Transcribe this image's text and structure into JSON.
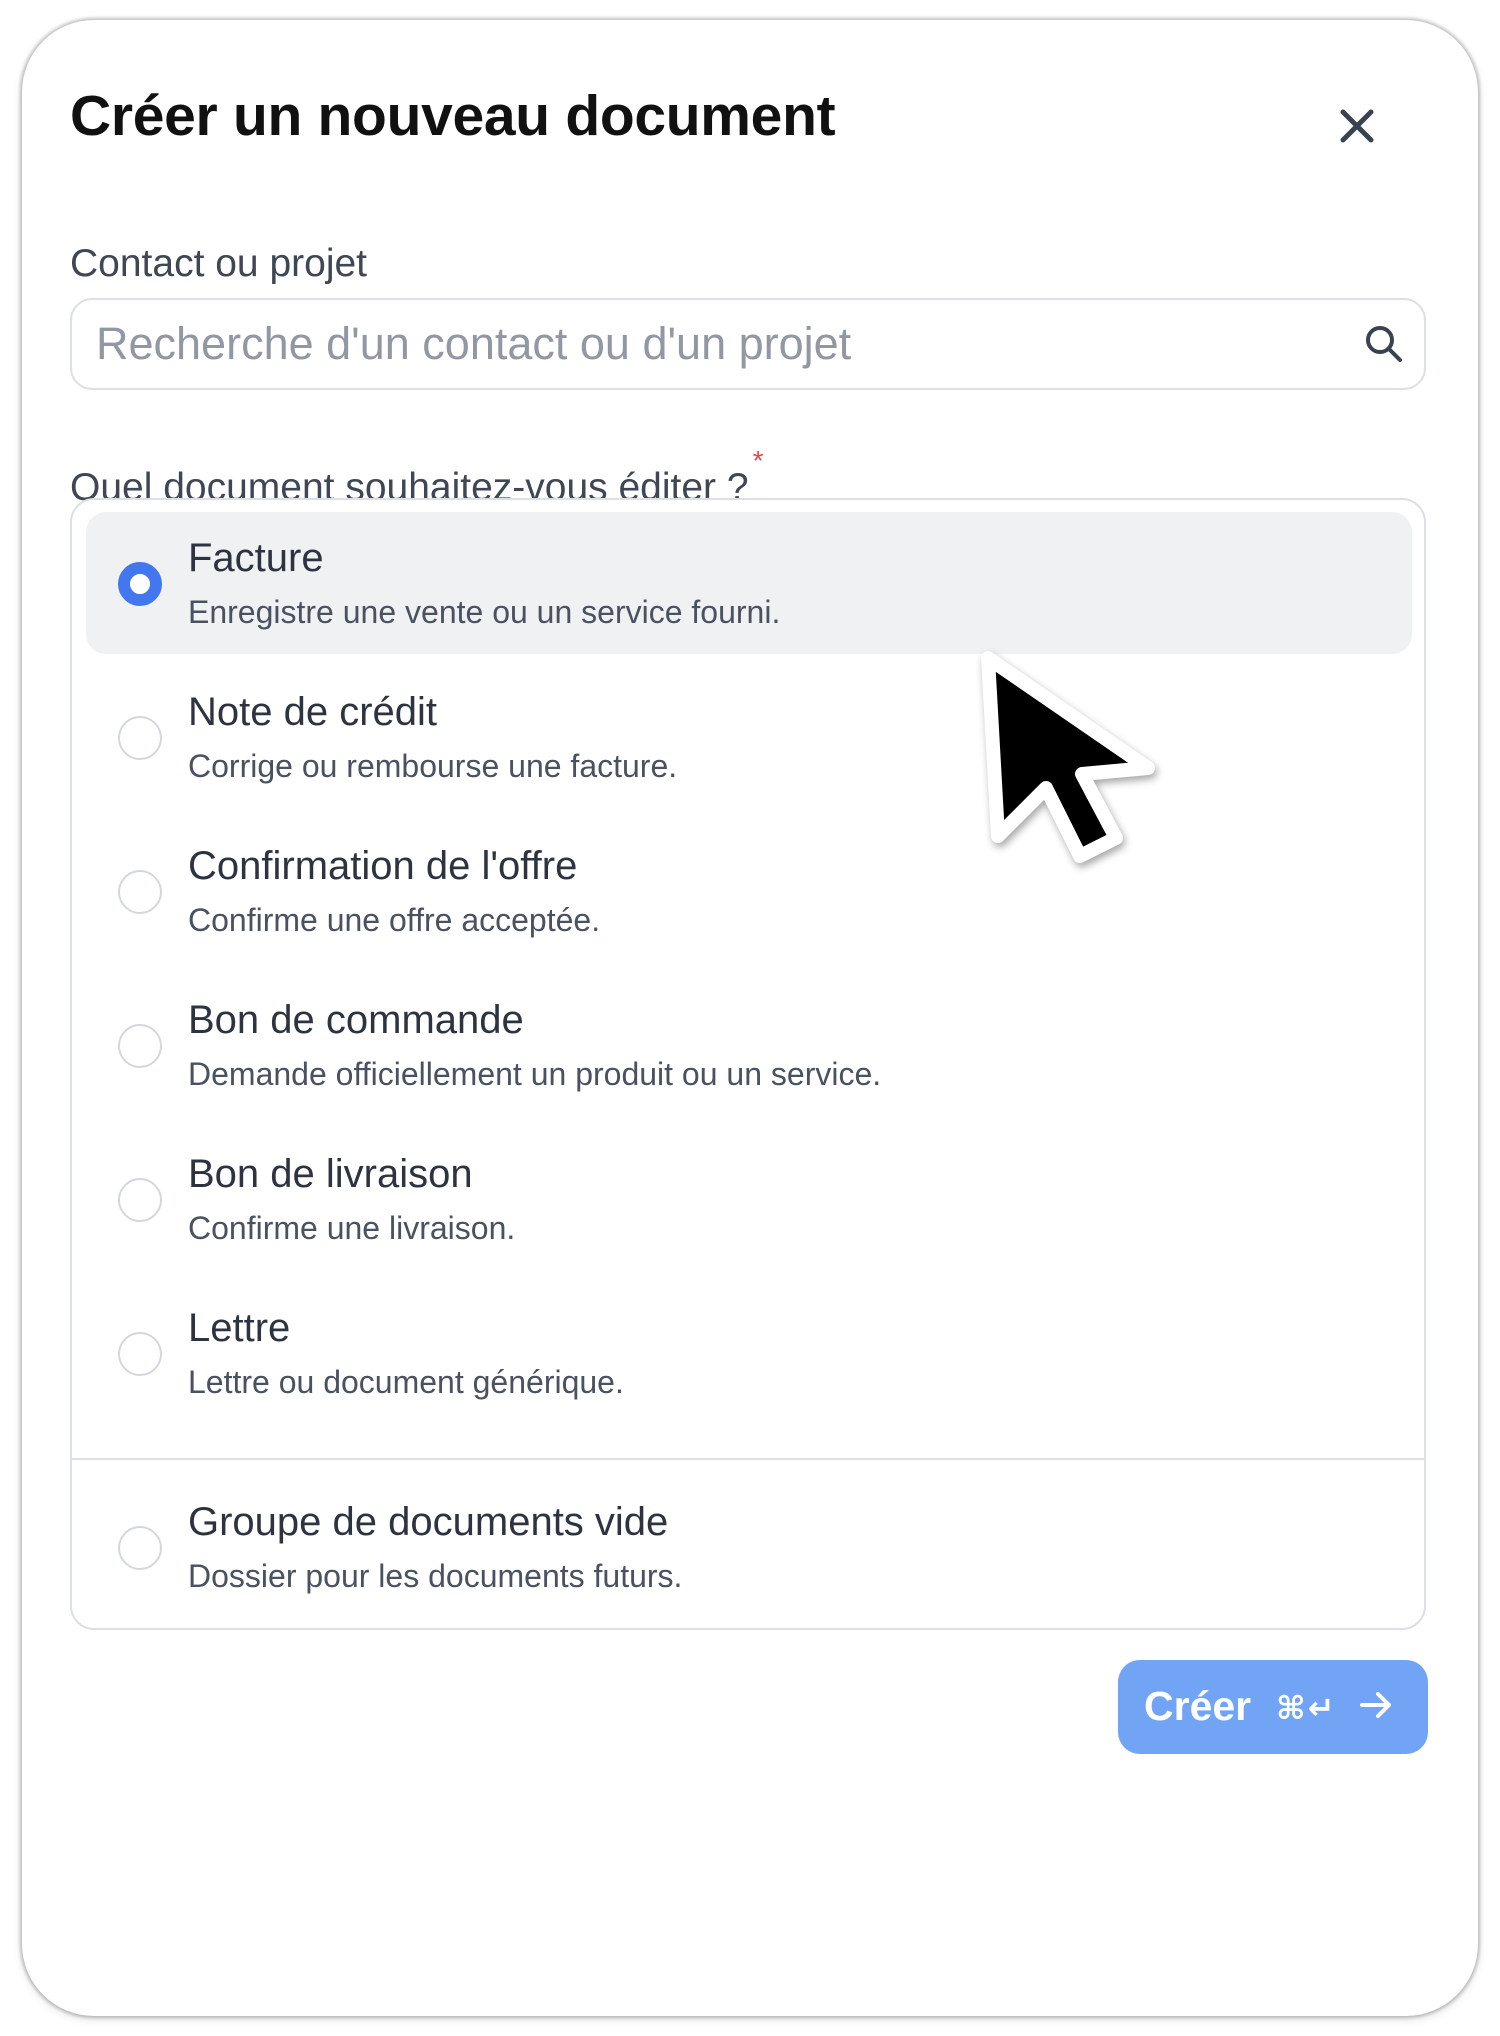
{
  "dialog": {
    "title": "Créer un nouveau document",
    "close_icon": "close-icon"
  },
  "contact": {
    "label": "Contact ou projet",
    "placeholder": "Recherche d'un contact ou d'un projet",
    "value": "",
    "icon": "search-icon"
  },
  "document_type": {
    "question": "Quel document souhaitez-vous éditer ?",
    "required_mark": "*",
    "selected_index": 0,
    "options": [
      {
        "title": "Facture",
        "description": "Enregistre une vente ou un service fourni."
      },
      {
        "title": "Note de crédit",
        "description": "Corrige ou rembourse une facture."
      },
      {
        "title": "Confirmation de l'offre",
        "description": "Confirme une offre acceptée."
      },
      {
        "title": "Bon de commande",
        "description": "Demande officiellement un produit ou un service."
      },
      {
        "title": "Bon de livraison",
        "description": "Confirme une livraison."
      },
      {
        "title": "Lettre",
        "description": "Lettre ou document générique."
      },
      {
        "title": "Groupe de documents vide",
        "description": "Dossier pour les documents futurs."
      }
    ]
  },
  "footer": {
    "create_label": "Créer",
    "shortcut": "⌘↵",
    "arrow_icon": "arrow-right-icon"
  },
  "colors": {
    "accent": "#4277f0",
    "button": "#71a4f5",
    "required": "#e5484d",
    "selected_row": "#f0f1f3"
  },
  "pointer": "mouse-cursor-icon"
}
